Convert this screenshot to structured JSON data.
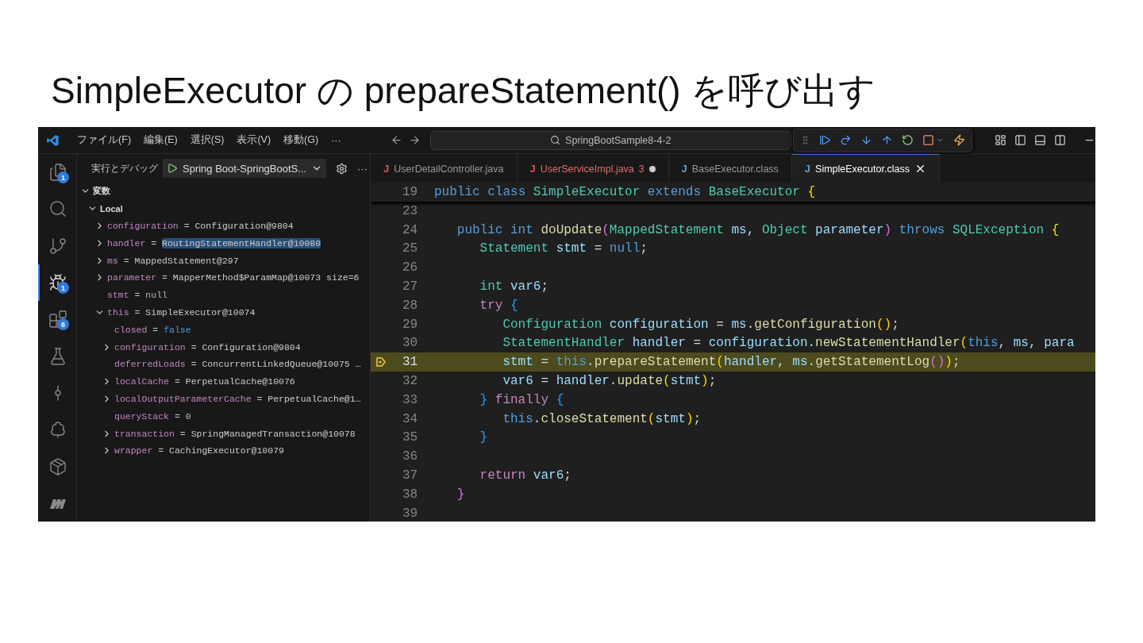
{
  "slide_title": "SimpleExecutor の prepareStatement() を呼び出す",
  "titlebar": {
    "menu": [
      "ファイル(F)",
      "編集(E)",
      "選択(S)",
      "表示(V)",
      "移動(G)",
      "···"
    ],
    "search": "SpringBootSample8-4-2"
  },
  "activity_bar": [
    {
      "kind": "files",
      "badge": "1",
      "selected": false
    },
    {
      "kind": "search",
      "selected": false
    },
    {
      "kind": "scm",
      "selected": false
    },
    {
      "kind": "debug",
      "badge": "1",
      "selected": true
    },
    {
      "kind": "extensions",
      "badge": "6",
      "selected": false
    },
    {
      "kind": "testing",
      "selected": false
    },
    {
      "kind": "graph",
      "selected": false
    },
    {
      "kind": "tree",
      "selected": false
    },
    {
      "kind": "container",
      "selected": false
    },
    {
      "kind": "logo",
      "selected": false
    }
  ],
  "debug_panel": {
    "title": "実行とデバッグ",
    "config": "Spring Boot-SpringBootS...",
    "more": "···",
    "section": {
      "title": "変数",
      "expanded": true
    },
    "scope": {
      "name": "Local",
      "expanded": true
    },
    "variables": [
      {
        "name": "configuration",
        "operator": "=",
        "value": "Configuration@9804",
        "kind": "object",
        "expanded": false,
        "selected": false
      },
      {
        "name": "handler",
        "operator": "=",
        "value": "RoutingStatementHandler@10080",
        "kind": "object",
        "expanded": false,
        "selected": true
      },
      {
        "name": "ms",
        "operator": "=",
        "value": "MappedStatement@297",
        "kind": "object",
        "expanded": false,
        "selected": false
      },
      {
        "name": "parameter",
        "operator": "=",
        "value": "MapperMethod$ParamMap@10073 size=6",
        "kind": "object",
        "expanded": false,
        "selected": false
      },
      {
        "name": "stmt",
        "operator": "=",
        "value": "null",
        "kind": "null",
        "selected": false
      },
      {
        "name": "this",
        "operator": "=",
        "value": "SimpleExecutor@10074",
        "kind": "object",
        "expanded": true,
        "selected": false,
        "children": [
          {
            "name": "closed",
            "operator": "=",
            "value": "false",
            "kind": "bool",
            "selected": false
          },
          {
            "name": "configuration",
            "operator": "=",
            "value": "Configuration@9804",
            "kind": "object",
            "expanded": false,
            "selected": false
          },
          {
            "name": "deferredLoads",
            "operator": "=",
            "value": "ConcurrentLinkedQueue@10075 …",
            "kind": "object",
            "selected": false
          },
          {
            "name": "localCache",
            "operator": "=",
            "value": "PerpetualCache@10076",
            "kind": "object",
            "expanded": false,
            "selected": false
          },
          {
            "name": "localOutputParameterCache",
            "operator": "=",
            "value": "PerpetualCache@1…",
            "kind": "object",
            "expanded": false,
            "selected": false
          },
          {
            "name": "queryStack",
            "operator": "=",
            "value": "0",
            "kind": "number",
            "selected": false
          },
          {
            "name": "transaction",
            "operator": "=",
            "value": "SpringManagedTransaction@10078",
            "kind": "object",
            "expanded": false,
            "selected": false
          },
          {
            "name": "wrapper",
            "operator": "=",
            "value": "CachingExecutor@10079",
            "kind": "object",
            "expanded": false,
            "selected": false
          }
        ]
      }
    ]
  },
  "tabs": [
    {
      "icon": "J",
      "label": "UserDetailController.java",
      "color": "#e05252",
      "error": false,
      "modified": false,
      "selected": false
    },
    {
      "icon": "J",
      "label": "UserServiceImpl.java",
      "color": "#e05252",
      "error": true,
      "problems": "3",
      "modified": true,
      "selected": false
    },
    {
      "icon": "J",
      "label": "BaseExecutor.class",
      "color": "#6c9bd2",
      "error": false,
      "modified": false,
      "selected": false
    },
    {
      "icon": "J",
      "label": "SimpleExecutor.class",
      "color": "#6c9bd2",
      "error": false,
      "modified": false,
      "selected": true
    }
  ],
  "editor": {
    "sticky_line": {
      "number": "19",
      "tokens": [
        {
          "kind": "kw",
          "text": "public "
        },
        {
          "kind": "kw",
          "text": "class "
        },
        {
          "kind": "type",
          "text": "SimpleExecutor "
        },
        {
          "kind": "kw",
          "text": "extends "
        },
        {
          "kind": "type",
          "text": "BaseExecutor "
        },
        {
          "kind": "b1",
          "text": "{"
        }
      ]
    },
    "lines": [
      {
        "number": "23",
        "current": false
      },
      {
        "number": "24",
        "current": false,
        "tokens": [
          {
            "kind": "kw",
            "text": "   public "
          },
          {
            "kind": "kw",
            "text": "int "
          },
          {
            "kind": "func",
            "text": "doUpdate"
          },
          {
            "kind": "b2",
            "text": "("
          },
          {
            "kind": "type",
            "text": "MappedStatement "
          },
          {
            "kind": "var",
            "text": "ms"
          },
          {
            "kind": "p",
            "text": ", "
          },
          {
            "kind": "type",
            "text": "Object "
          },
          {
            "kind": "var",
            "text": "parameter"
          },
          {
            "kind": "b2",
            "text": ") "
          },
          {
            "kind": "kw",
            "text": "throws "
          },
          {
            "kind": "type",
            "text": "SQLException "
          },
          {
            "kind": "b1",
            "text": "{"
          }
        ]
      },
      {
        "number": "25",
        "current": false,
        "tokens": [
          {
            "kind": "type",
            "text": "      Statement "
          },
          {
            "kind": "var",
            "text": "stmt"
          },
          {
            "kind": "p",
            "text": " = "
          },
          {
            "kind": "kw",
            "text": "null"
          },
          {
            "kind": "p",
            "text": ";"
          }
        ]
      },
      {
        "number": "26",
        "current": false
      },
      {
        "number": "27",
        "current": false,
        "tokens": [
          {
            "kind": "type",
            "text": "      int "
          },
          {
            "kind": "var",
            "text": "var6"
          },
          {
            "kind": "p",
            "text": ";"
          }
        ]
      },
      {
        "number": "28",
        "current": false,
        "tokens": [
          {
            "kind": "ctrl",
            "text": "      try "
          },
          {
            "kind": "b3",
            "text": "{"
          }
        ]
      },
      {
        "number": "29",
        "current": false,
        "tokens": [
          {
            "kind": "type",
            "text": "         Configuration "
          },
          {
            "kind": "var",
            "text": "configuration"
          },
          {
            "kind": "p",
            "text": " = "
          },
          {
            "kind": "var",
            "text": "ms"
          },
          {
            "kind": "p",
            "text": "."
          },
          {
            "kind": "func",
            "text": "getConfiguration"
          },
          {
            "kind": "b1",
            "text": "()"
          },
          {
            "kind": "p",
            "text": ";"
          }
        ]
      },
      {
        "number": "30",
        "current": false,
        "tokens": [
          {
            "kind": "type",
            "text": "         StatementHandler "
          },
          {
            "kind": "var",
            "text": "handler"
          },
          {
            "kind": "p",
            "text": " = "
          },
          {
            "kind": "var",
            "text": "configuration"
          },
          {
            "kind": "p",
            "text": "."
          },
          {
            "kind": "func",
            "text": "newStatementHandler"
          },
          {
            "kind": "b1",
            "text": "("
          },
          {
            "kind": "kw",
            "text": "this"
          },
          {
            "kind": "p",
            "text": ", "
          },
          {
            "kind": "var",
            "text": "ms"
          },
          {
            "kind": "p",
            "text": ", "
          },
          {
            "kind": "var",
            "text": "para"
          }
        ]
      },
      {
        "number": "31",
        "current": true,
        "tokens": [
          {
            "kind": "var",
            "text": "         stmt"
          },
          {
            "kind": "p",
            "text": " = "
          },
          {
            "kind": "kw",
            "text": "this"
          },
          {
            "kind": "p",
            "text": "."
          },
          {
            "kind": "func",
            "text": "prepareStatement"
          },
          {
            "kind": "b1",
            "text": "("
          },
          {
            "kind": "var",
            "text": "handler"
          },
          {
            "kind": "p",
            "text": ", "
          },
          {
            "kind": "var",
            "text": "ms"
          },
          {
            "kind": "p",
            "text": "."
          },
          {
            "kind": "func",
            "text": "getStatementLog"
          },
          {
            "kind": "b2",
            "text": "()"
          },
          {
            "kind": "b1",
            "text": ")"
          },
          {
            "kind": "p",
            "text": ";"
          }
        ]
      },
      {
        "number": "32",
        "current": false,
        "tokens": [
          {
            "kind": "var",
            "text": "         var6"
          },
          {
            "kind": "p",
            "text": " = "
          },
          {
            "kind": "var",
            "text": "handler"
          },
          {
            "kind": "p",
            "text": "."
          },
          {
            "kind": "func",
            "text": "update"
          },
          {
            "kind": "b1",
            "text": "("
          },
          {
            "kind": "var",
            "text": "stmt"
          },
          {
            "kind": "b1",
            "text": ")"
          },
          {
            "kind": "p",
            "text": ";"
          }
        ]
      },
      {
        "number": "33",
        "current": false,
        "tokens": [
          {
            "kind": "b3",
            "text": "      } "
          },
          {
            "kind": "ctrl",
            "text": "finally "
          },
          {
            "kind": "b3",
            "text": "{"
          }
        ]
      },
      {
        "number": "34",
        "current": false,
        "tokens": [
          {
            "kind": "kw",
            "text": "         this"
          },
          {
            "kind": "p",
            "text": "."
          },
          {
            "kind": "func",
            "text": "closeStatement"
          },
          {
            "kind": "b1",
            "text": "("
          },
          {
            "kind": "var",
            "text": "stmt"
          },
          {
            "kind": "b1",
            "text": ")"
          },
          {
            "kind": "p",
            "text": ";"
          }
        ]
      },
      {
        "number": "35",
        "current": false,
        "tokens": [
          {
            "kind": "b3",
            "text": "      }"
          }
        ]
      },
      {
        "number": "36",
        "current": false
      },
      {
        "number": "37",
        "current": false,
        "tokens": [
          {
            "kind": "ctrl",
            "text": "      return "
          },
          {
            "kind": "var",
            "text": "var6"
          },
          {
            "kind": "p",
            "text": ";"
          }
        ]
      },
      {
        "number": "38",
        "current": false,
        "tokens": [
          {
            "kind": "b2",
            "text": "   }"
          }
        ]
      },
      {
        "number": "39",
        "current": false
      }
    ]
  }
}
